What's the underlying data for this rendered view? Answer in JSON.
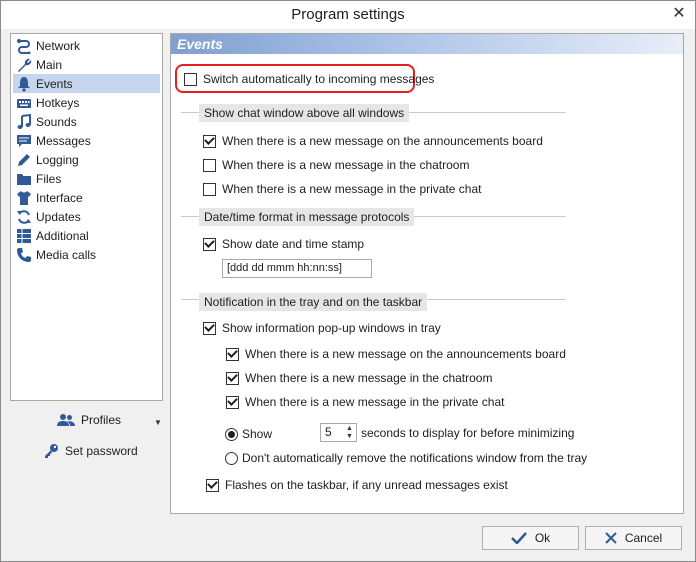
{
  "window": {
    "title": "Program settings"
  },
  "sidebar": {
    "items": [
      {
        "label": "Network",
        "icon": "network-icon"
      },
      {
        "label": "Main",
        "icon": "wrench-icon"
      },
      {
        "label": "Events",
        "icon": "bell-icon",
        "selected": true
      },
      {
        "label": "Hotkeys",
        "icon": "keyboard-icon"
      },
      {
        "label": "Sounds",
        "icon": "music-note-icon"
      },
      {
        "label": "Messages",
        "icon": "messages-icon"
      },
      {
        "label": "Logging",
        "icon": "pencil-icon"
      },
      {
        "label": "Files",
        "icon": "folder-icon"
      },
      {
        "label": "Interface",
        "icon": "shirt-icon"
      },
      {
        "label": "Updates",
        "icon": "refresh-icon"
      },
      {
        "label": "Additional",
        "icon": "grid-icon"
      },
      {
        "label": "Media calls",
        "icon": "phone-icon"
      }
    ],
    "profiles_label": "Profiles",
    "set_password_label": "Set password"
  },
  "panel": {
    "header": "Events",
    "switch_auto": {
      "label": "Switch automatically to incoming messages",
      "checked": false
    },
    "group_chat": {
      "title": "Show chat window above all windows",
      "options": [
        {
          "label": "When there is a new message on the announcements board",
          "checked": true
        },
        {
          "label": "When there is a new message in the chatroom",
          "checked": false
        },
        {
          "label": "When there is a new message in the private chat",
          "checked": false
        }
      ]
    },
    "group_datetime": {
      "title": "Date/time format in message protocols",
      "show_stamp": {
        "label": "Show date and time stamp",
        "checked": true
      },
      "format_value": "[ddd dd mmm hh:nn:ss]"
    },
    "group_tray": {
      "title": "Notification in the tray and on the taskbar",
      "show_popups": {
        "label": "Show information pop-up windows in tray",
        "checked": true
      },
      "sub_options": [
        {
          "label": "When there is a new message on the announcements board",
          "checked": true
        },
        {
          "label": "When there is a new message in the chatroom",
          "checked": true
        },
        {
          "label": "When there is a new message in the private chat",
          "checked": true
        }
      ],
      "radio_show_label": "Show",
      "seconds_value": "5",
      "seconds_suffix": "seconds to display for before minimizing",
      "radio_dont_remove_label": "Don't automatically remove the notifications window from the tray",
      "flashes": {
        "label": "Flashes on the taskbar, if any unread messages exist",
        "checked": true
      }
    }
  },
  "footer": {
    "ok_label": "Ok",
    "cancel_label": "Cancel"
  },
  "colors": {
    "selection": "#c5d6ee",
    "header_gradient_start": "#7f9fd0",
    "highlight_red": "#e0201c",
    "accent_blue": "#2f6db5"
  }
}
